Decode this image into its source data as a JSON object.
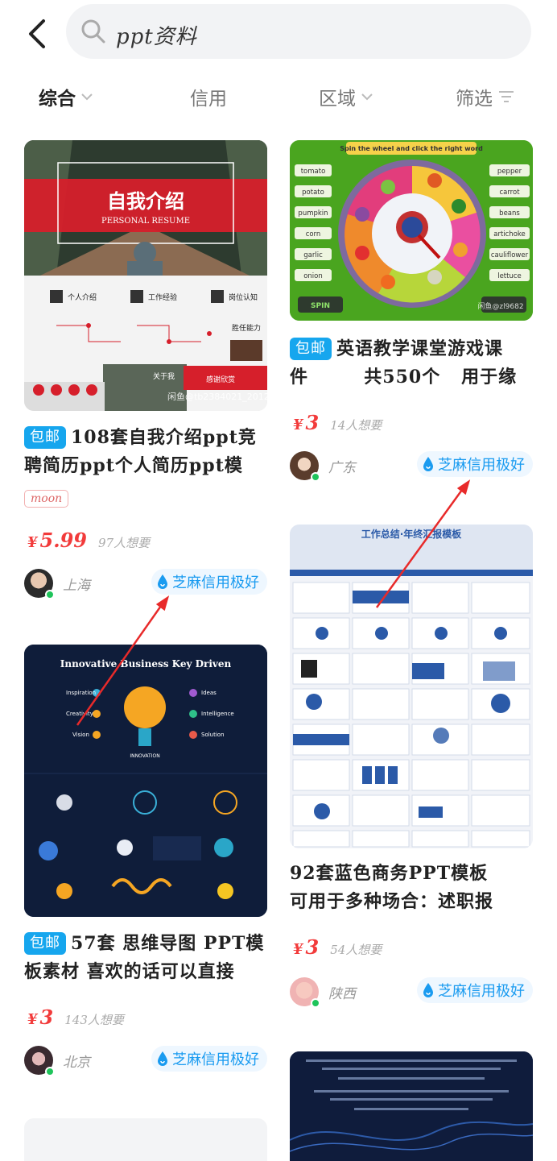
{
  "search": {
    "query": "ppt资料"
  },
  "filters": [
    {
      "label": "综合",
      "active": true,
      "has_chevron": true
    },
    {
      "label": "信用",
      "active": false,
      "has_chevron": false
    },
    {
      "label": "区域",
      "active": false,
      "has_chevron": true
    },
    {
      "label": "筛选",
      "active": false,
      "has_chevron": false
    }
  ],
  "cards": [
    {
      "thumb_title": "自我介绍",
      "thumb_subtitle": "PERSONAL RESUME",
      "thumb_labels": [
        "个人介绍",
        "工作经验",
        "岗位认知",
        "胜任能力",
        "关于我",
        "感谢欣赏"
      ],
      "thumb_watermark": "闲鱼@tb2384021_2012",
      "badge": "包邮",
      "title_line1": "108套自我介绍ppt竞",
      "title_line2": "聘简历ppt个人简历ppt模",
      "tag": "moon",
      "price_currency": "¥",
      "price": "5.99",
      "wants": "97人想要",
      "city": "上海",
      "credit": "芝麻信用极好"
    },
    {
      "thumb_banner": "Spin the wheel and click the right word",
      "thumb_words_left": [
        "tomato",
        "potato",
        "pumpkin",
        "corn",
        "garlic",
        "onion"
      ],
      "thumb_words_right": [
        "pepper",
        "carrot",
        "beans",
        "artichoke",
        "cauliflower",
        "lettuce"
      ],
      "thumb_button": "SPIN",
      "thumb_watermark": "闲鱼@zl9682",
      "badge": "包邮",
      "title_line1": "英语教学课堂游戏课",
      "title_line2": "件        共550个   用于缘",
      "price_currency": "¥",
      "price": "3",
      "wants": "14人想要",
      "city": "广东",
      "credit": "芝麻信用极好"
    },
    {
      "thumb_title": "Innovative Business Key Driven",
      "thumb_labels": [
        "Inspiration",
        "Creativity",
        "Vision",
        "Ideas",
        "Intelligence",
        "Solution",
        "INNOVATION"
      ],
      "badge": "包邮",
      "title_line1": "57套 思维导图 PPT模",
      "title_line2": "板素材 喜欢的话可以直接",
      "price_currency": "¥",
      "price": "3",
      "wants": "143人想要",
      "city": "北京",
      "credit": "芝麻信用极好"
    },
    {
      "thumb_title": "工作总结·年终汇报模板",
      "title_line1": "92套蓝色商务PPT模板",
      "title_line2": "可用于多种场合：述职报",
      "price_currency": "¥",
      "price": "3",
      "wants": "54人想要",
      "city": "陕西",
      "credit": "芝麻信用极好"
    }
  ],
  "colors": {
    "accent_blue": "#16a6ee",
    "price_red": "#f23b3b",
    "online_green": "#1fc45b"
  }
}
